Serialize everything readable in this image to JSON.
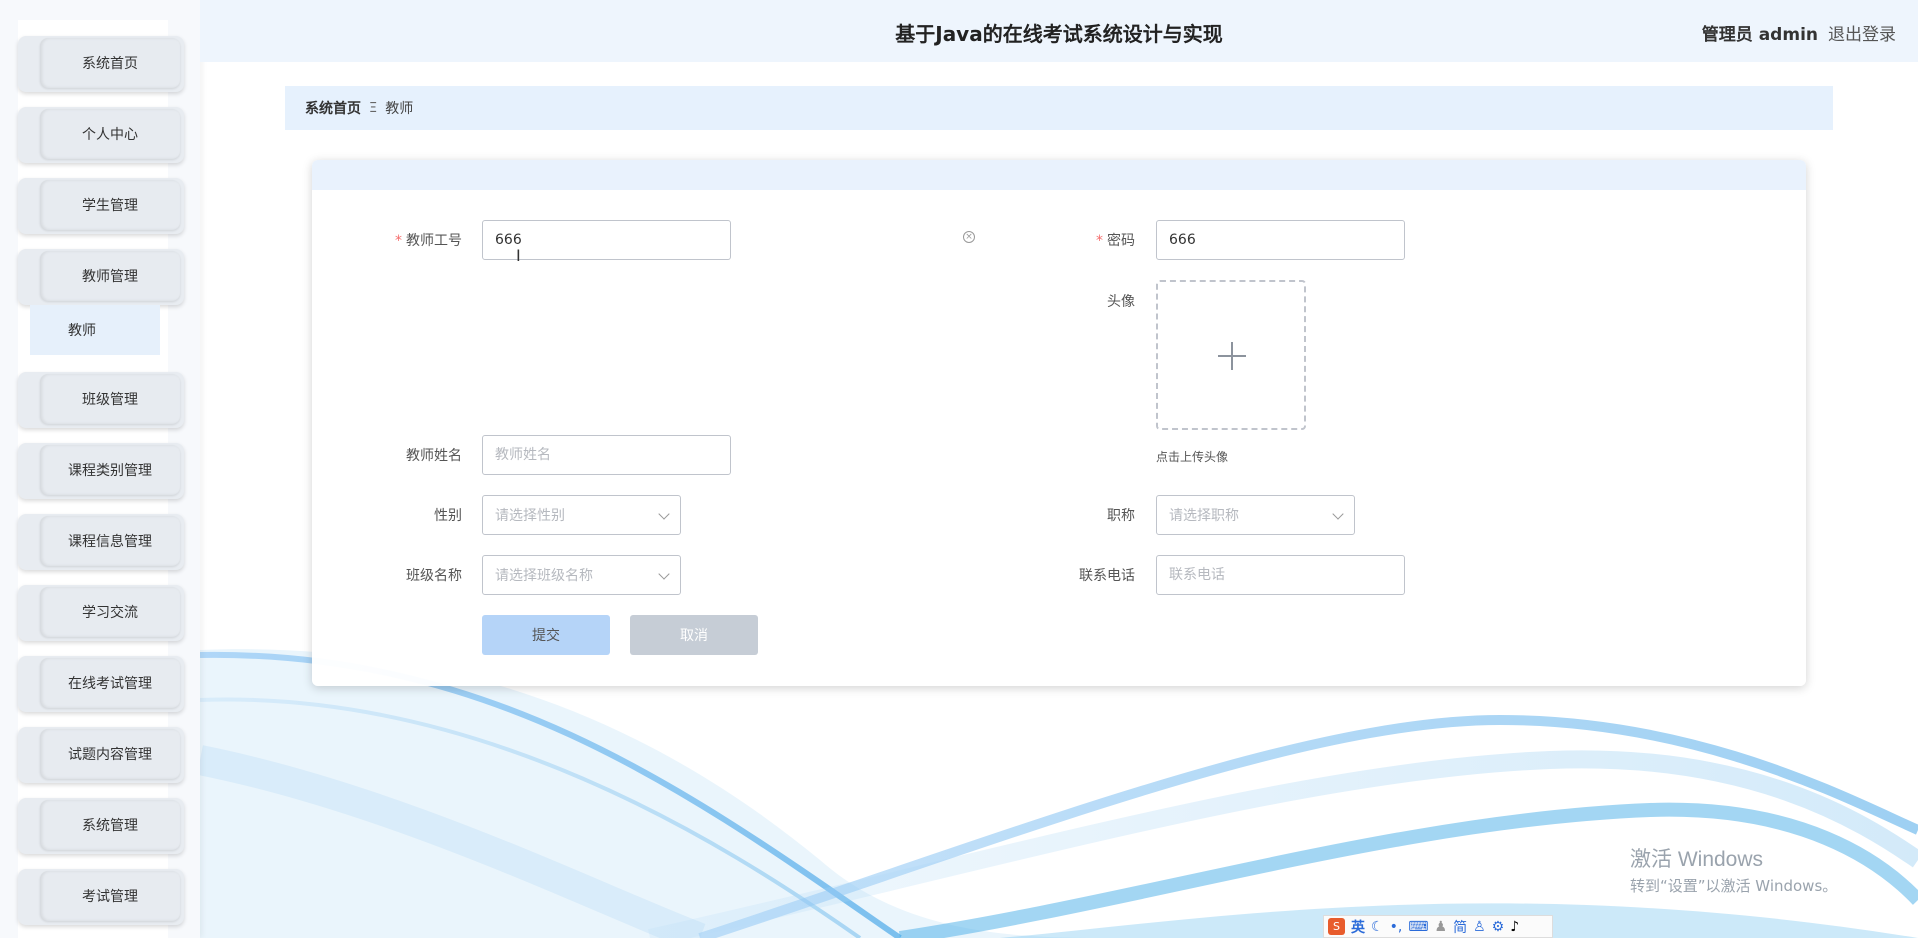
{
  "header": {
    "title": "基于Java的在线考试系统设计与实现",
    "user_label": "管理员 admin",
    "logout_label": "退出登录"
  },
  "sidebar": {
    "items": [
      {
        "label": "系统首页"
      },
      {
        "label": "个人中心"
      },
      {
        "label": "学生管理"
      },
      {
        "label": "教师管理"
      },
      {
        "label": "班级管理"
      },
      {
        "label": "课程类别管理"
      },
      {
        "label": "课程信息管理"
      },
      {
        "label": "学习交流"
      },
      {
        "label": "在线考试管理"
      },
      {
        "label": "试题内容管理"
      },
      {
        "label": "系统管理"
      },
      {
        "label": "考试管理"
      }
    ],
    "submenu": {
      "label": "教师"
    }
  },
  "breadcrumb": {
    "home": "系统首页",
    "separator": "Ξ",
    "current": "教师"
  },
  "form": {
    "teacher_id": {
      "label": "教师工号",
      "value": "666",
      "required": true
    },
    "password": {
      "label": "密码",
      "value": "666",
      "required": true
    },
    "avatar": {
      "label": "头像",
      "tip": "点击上传头像"
    },
    "teacher_name": {
      "label": "教师姓名",
      "placeholder": "教师姓名",
      "value": ""
    },
    "gender": {
      "label": "性别",
      "placeholder": "请选择性别"
    },
    "title": {
      "label": "职称",
      "placeholder": "请选择职称"
    },
    "class_name": {
      "label": "班级名称",
      "placeholder": "请选择班级名称"
    },
    "phone": {
      "label": "联系电话",
      "placeholder": "联系电话"
    },
    "submit_label": "提交",
    "cancel_label": "取消"
  },
  "watermark": {
    "line1": "激活 Windows",
    "line2": "转到“设置”以激活 Windows。"
  },
  "ime": {
    "logo": "S",
    "lang": "英",
    "mode": "简"
  },
  "colors": {
    "accent": "#b5d4f8",
    "header_bg": "#eef5fd",
    "required": "#f56c6c"
  }
}
